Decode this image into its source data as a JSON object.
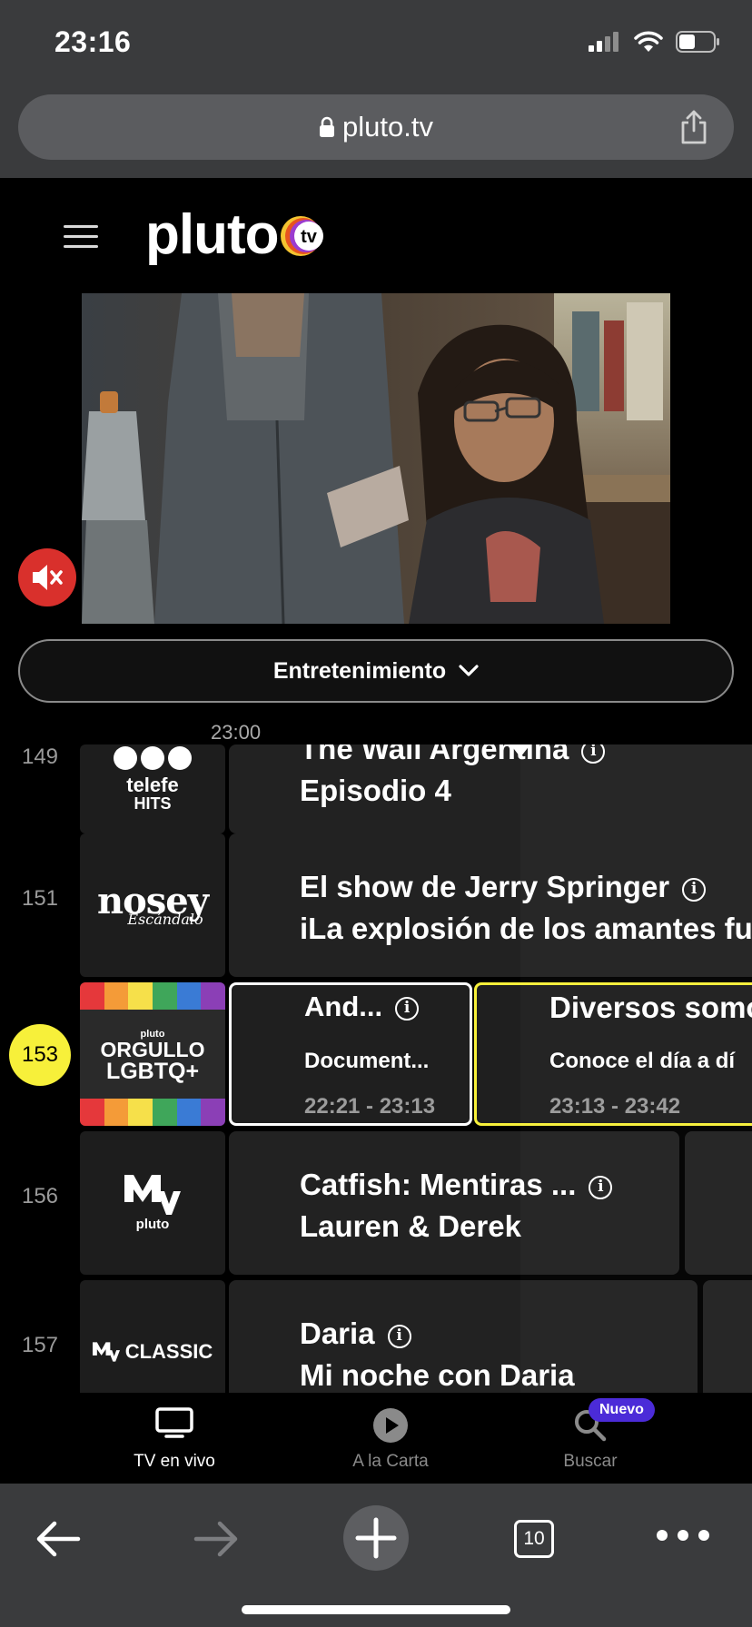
{
  "status_bar": {
    "time": "23:16"
  },
  "browser": {
    "url": "pluto.tv",
    "tabs_count": "10"
  },
  "app": {
    "logo_text": "pluto",
    "logo_badge": "tv"
  },
  "category": {
    "label": "Entretenimiento"
  },
  "guide": {
    "time_label": "23:00",
    "channels": [
      {
        "number": "149",
        "logo_text_1": "telefe",
        "logo_text_2": "HITS",
        "program_title": "The Wall Argentina",
        "program_subtitle": "Episodio 4"
      },
      {
        "number": "151",
        "logo_text": "nosey",
        "logo_sub": "Escándalo",
        "program_title": "El show de Jerry Springer",
        "program_subtitle": "iLa explosión de los amantes fu"
      },
      {
        "number": "153",
        "logo_small": "pluto",
        "logo_text_1": "ORGULLO",
        "logo_text_2": "LGBTQ+",
        "current": {
          "title": "And...",
          "subtitle": "Document...",
          "time": "22:21 - 23:13"
        },
        "next": {
          "title": "Diversos somo",
          "subtitle": "Conoce el día a dí",
          "time": "23:13 - 23:42"
        }
      },
      {
        "number": "156",
        "logo_sub": "pluto",
        "program_title": "Catfish: Mentiras ...",
        "program_subtitle": "Lauren & Derek"
      },
      {
        "number": "157",
        "logo_text": "CLASSIC",
        "program_title": "Daria",
        "program_subtitle": "Mi noche con Daria"
      }
    ]
  },
  "tabs": [
    {
      "label": "TV en vivo",
      "icon": "tv-icon",
      "active": true
    },
    {
      "label": "A la Carta",
      "icon": "play-icon",
      "active": false
    },
    {
      "label": "Buscar",
      "icon": "search-icon",
      "active": false,
      "badge": "Nuevo"
    }
  ],
  "colors": {
    "accent_yellow": "#f7f03a",
    "mute_red": "#d9302c",
    "badge_purple": "#4b2bd8"
  }
}
